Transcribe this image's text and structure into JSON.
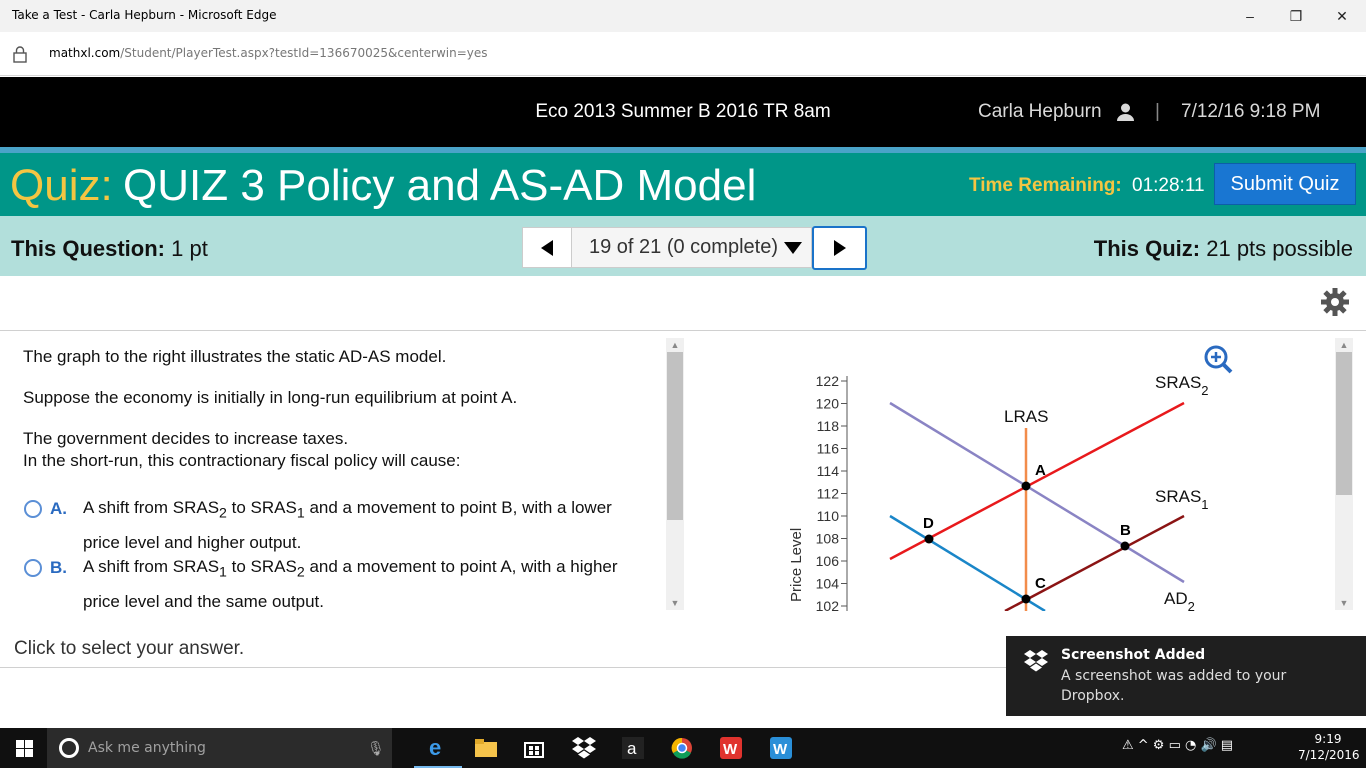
{
  "window": {
    "title": "Take a Test - Carla Hepburn - Microsoft Edge",
    "minimize": "–",
    "restore": "❐",
    "close": "✕"
  },
  "address": {
    "host": "mathxl.com",
    "path": "/Student/PlayerTest.aspx?testId=136670025&centerwin=yes"
  },
  "header": {
    "course": "Eco 2013 Summer B 2016 TR 8am",
    "user": "Carla Hepburn",
    "separator": "|",
    "datetime": "7/12/16 9:18 PM"
  },
  "quiz": {
    "label": "Quiz:",
    "title": "QUIZ 3 Policy and AS-AD Model",
    "time_label": "Time Remaining:",
    "time_value": "01:28:11",
    "submit": "Submit Quiz"
  },
  "question_bar": {
    "this_question_label": "This Question:",
    "this_question_value": "1 pt",
    "selector": "19 of 21 (0 complete)",
    "this_quiz_label": "This Quiz:",
    "this_quiz_value": "21 pts possible"
  },
  "question": {
    "intro": "The graph to the right illustrates the static AD-AS model.",
    "line2": "Suppose the economy is initially in long-run equilibrium at point A.",
    "line3": "The government decides to increase taxes.",
    "line4": "In the short-run, this contractionary fiscal policy will cause:",
    "options": [
      {
        "letter": "A.",
        "p1": "A shift from SRAS",
        "s1": "2",
        "p2": " to SRAS",
        "s2": "1",
        "p3": " and a movement to point B, with a lower price level and higher output."
      },
      {
        "letter": "B.",
        "p1": "A shift from SRAS",
        "s1": "1",
        "p2": " to SRAS",
        "s2": "2",
        "p3": " and a movement to point A, with a higher price level and the same output."
      }
    ]
  },
  "graph": {
    "ylabel": "Price Level",
    "y_ticks": [
      "122",
      "120",
      "118",
      "116",
      "114",
      "112",
      "110",
      "108",
      "106",
      "104",
      "102"
    ],
    "curves": {
      "lras": "LRAS",
      "sras": "SRAS",
      "sras2_sub": "2",
      "sras1_sub": "1",
      "ad": "AD",
      "ad2_sub": "2"
    },
    "points": [
      "A",
      "B",
      "C",
      "D"
    ],
    "colors": {
      "lras": "#f28c4a",
      "sras2": "#e8191c",
      "sras1": "#8b1414",
      "ad2": "#8a84c4",
      "ad1": "#1a86c8"
    }
  },
  "footer": {
    "instruction": "Click to select your answer."
  },
  "toast": {
    "title": "Screenshot Added",
    "body": "A screenshot was added to your Dropbox."
  },
  "taskbar": {
    "search_placeholder": "Ask me anything",
    "time": "9:19",
    "date": "7/12/2016"
  }
}
